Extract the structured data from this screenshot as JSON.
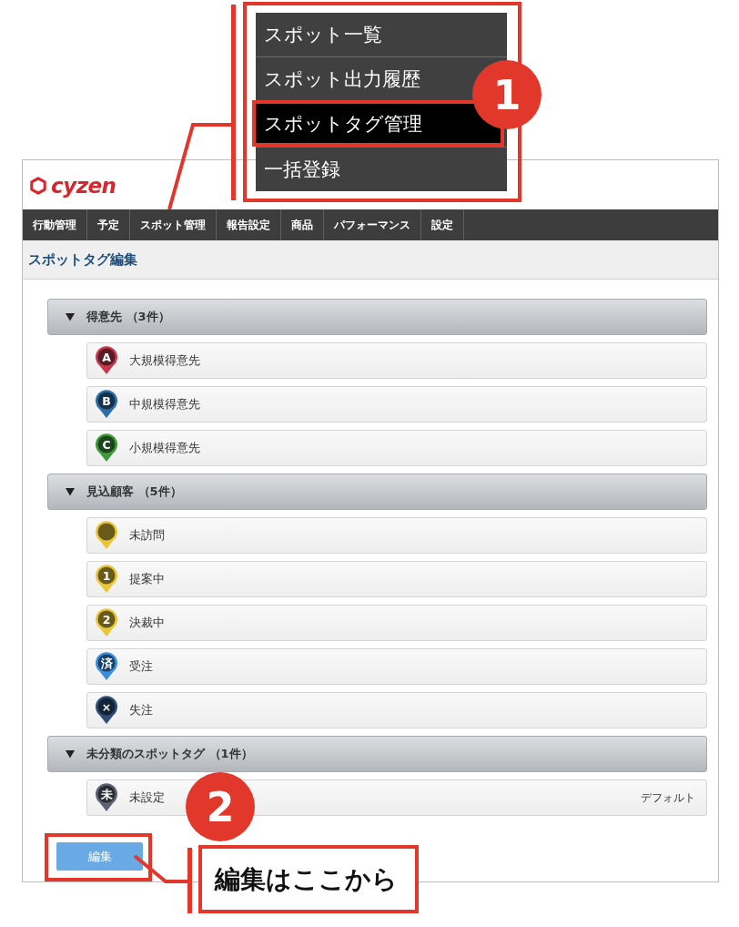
{
  "app": {
    "logo_text": "cyzen",
    "nav": [
      {
        "label": "行動管理"
      },
      {
        "label": "予定"
      },
      {
        "label": "スポット管理"
      },
      {
        "label": "報告設定"
      },
      {
        "label": "商品"
      },
      {
        "label": "パフォーマンス"
      },
      {
        "label": "設定"
      }
    ],
    "page_title": "スポットタグ編集",
    "groups": [
      {
        "title": "得意先 （3件）",
        "expanded": true,
        "tags": [
          {
            "name": "大規模得意先",
            "marker": "A",
            "color": "#c8384f"
          },
          {
            "name": "中規模得意先",
            "marker": "B",
            "color": "#2f6fa8"
          },
          {
            "name": "小規模得意先",
            "marker": "C",
            "color": "#3f9a3a"
          }
        ]
      },
      {
        "title": "見込顧客 （5件）",
        "expanded": true,
        "tags": [
          {
            "name": "未訪問",
            "color": "#e8c83a"
          },
          {
            "name": "提案中",
            "marker": "1",
            "color": "#e8c83a"
          },
          {
            "name": "決裁中",
            "marker": "2",
            "color": "#e8c83a"
          },
          {
            "name": "受注",
            "marker": "済",
            "color": "#3a8ee0"
          },
          {
            "name": "失注",
            "marker": "×",
            "color": "#2d4f78"
          }
        ]
      },
      {
        "title": "未分類のスポットタグ （1件）",
        "expanded": true,
        "tags": [
          {
            "name": "未設定",
            "marker": "未",
            "color": "#5e6272",
            "note": "デフォルト"
          }
        ]
      }
    ],
    "edit_button": "編集"
  },
  "annotations": {
    "menu": [
      {
        "label": "スポット一覧",
        "selected": false
      },
      {
        "label": "スポット出力履歴",
        "selected": false
      },
      {
        "label": "スポットタグ管理",
        "selected": true
      },
      {
        "label": "一括登録",
        "selected": false
      }
    ],
    "step_badges": [
      "1",
      "2"
    ],
    "callout": "編集はここから"
  }
}
